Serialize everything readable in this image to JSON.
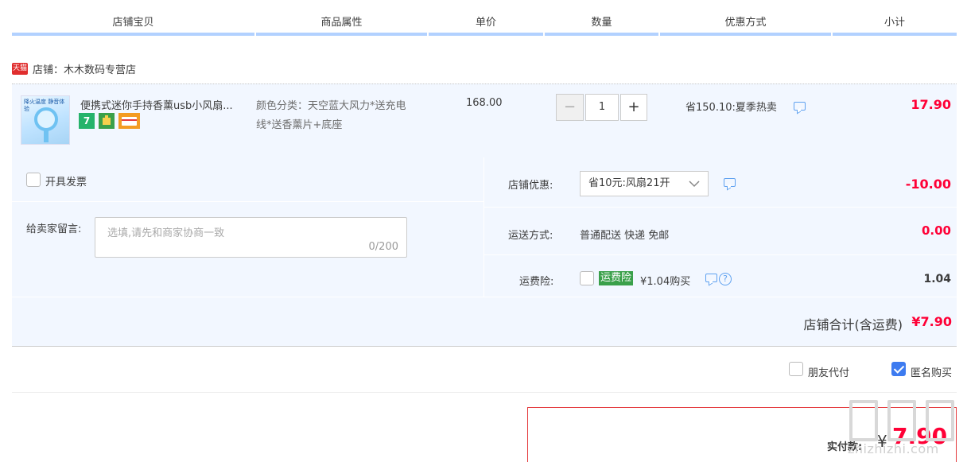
{
  "columns": [
    "店铺宝贝",
    "商品属性",
    "单价",
    "数量",
    "优惠方式",
    "小计"
  ],
  "shop": {
    "badge": "天猫",
    "label": "店铺：木木数码专营店"
  },
  "item": {
    "thumb_caption": "降火温度 静音体验",
    "title": "便携式迷你手持香薰usb小风扇...",
    "badge_icons": [
      "seven-day-icon",
      "guarantee-icon",
      "card-icon"
    ],
    "badge_seven": "7",
    "attr_line1": "颜色分类：天空蓝大风力*送充电",
    "attr_line2": "线*送香薰片+底座",
    "unit_price": "168.00",
    "qty_minus": "−",
    "qty_value": "1",
    "qty_plus": "+",
    "discount": "省150.10:夏季热卖",
    "subtotal": "17.90"
  },
  "invoice_label": "开具发票",
  "message": {
    "label": "给卖家留言:",
    "placeholder": "选填,请先和商家协商一致",
    "counter": "0/200"
  },
  "shop_discount": {
    "label": "店铺优惠:",
    "value": "省10元:风扇21开",
    "amount": "-10.00"
  },
  "shipping": {
    "label": "运送方式:",
    "value": "普通配送 快递 免邮",
    "amount": "0.00"
  },
  "insurance": {
    "label": "运费险:",
    "tag": "运费险",
    "value": "¥1.04购买",
    "amount": "1.04",
    "help": "?"
  },
  "shop_total": {
    "label": "店铺合计(含运费)",
    "amount": "¥7.90"
  },
  "options": {
    "friend_pay": "朋友代付",
    "anonymous": "匿名购买",
    "anonymous_checked": true
  },
  "payment": {
    "label": "实付款:",
    "currency": "¥",
    "amount": "7.90"
  },
  "watermark": "zhizhizhi.com",
  "colors": {
    "accent_red": "#ff0036",
    "header_bar": "#b2d1ff",
    "panel_bg": "#f2f7ff",
    "checkbox_blue": "#3d7bf0",
    "insurance_green": "#3aa04a"
  }
}
